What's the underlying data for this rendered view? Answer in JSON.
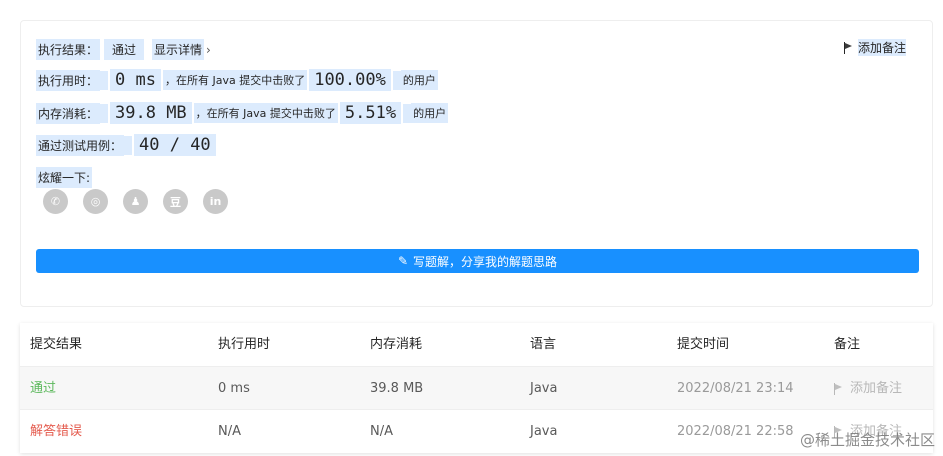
{
  "result": {
    "label": "执行结果：",
    "status": "通过",
    "detail_link": "显示详情",
    "detail_chevron": "›",
    "add_note": "添加备注"
  },
  "runtime": {
    "label": "执行用时：",
    "value": "0 ms",
    "mid": "，在所有 Java 提交中击败了",
    "percent": "100.00%",
    "suffix": "的用户"
  },
  "memory": {
    "label": "内存消耗：",
    "value": "39.8 MB",
    "mid": "，在所有 Java 提交中击败了",
    "percent": "5.51%",
    "suffix": "的用户"
  },
  "cases": {
    "label": "通过测试用例：",
    "value": "40 / 40"
  },
  "share": {
    "label": "炫耀一下:",
    "icons": [
      {
        "name": "wechat-icon",
        "glyph": "✆"
      },
      {
        "name": "weibo-icon",
        "glyph": "◎"
      },
      {
        "name": "qq-icon",
        "glyph": "♟"
      },
      {
        "name": "douban-icon",
        "glyph": "豆"
      },
      {
        "name": "linkedin-icon",
        "glyph": "in"
      }
    ]
  },
  "write_solution": {
    "label": "写题解，分享我的解题思路"
  },
  "table": {
    "headers": [
      "提交结果",
      "执行用时",
      "内存消耗",
      "语言",
      "提交时间",
      "备注"
    ],
    "rows": [
      {
        "result": "通过",
        "time": "0 ms",
        "memory": "39.8 MB",
        "lang": "Java",
        "submitted": "2022/08/21 23:14",
        "note": "添加备注"
      },
      {
        "result": "解答错误",
        "time": "N/A",
        "memory": "N/A",
        "lang": "Java",
        "submitted": "2022/08/21 22:58",
        "note": "添加备注"
      }
    ]
  },
  "watermark": "@稀土掘金技术社区",
  "colors": {
    "accent": "#1890ff",
    "highlight": "#dcebfd",
    "pass": "#5cb85c",
    "error": "#e45b4e"
  }
}
